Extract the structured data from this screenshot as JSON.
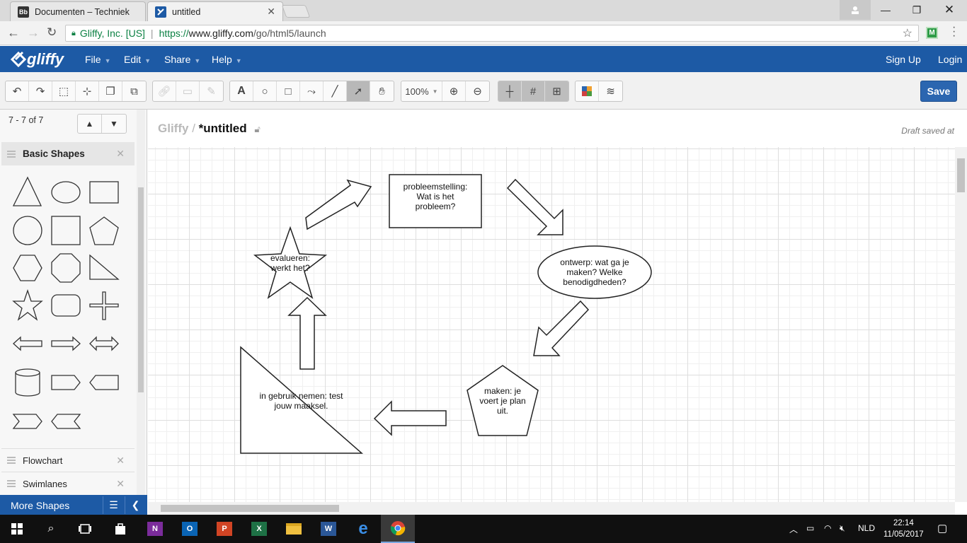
{
  "browser": {
    "tabs": [
      {
        "title": "Documenten – Techniek",
        "favicon": "Bb"
      },
      {
        "title": "untitled"
      }
    ],
    "address": {
      "secure_label": "Gliffy, Inc. [US]",
      "url_prefix": "https://",
      "url_host": "www.gliffy.com",
      "url_path": "/go/html5/launch"
    },
    "extension_label": "M"
  },
  "app": {
    "logo": "gliffy",
    "menu": [
      "File",
      "Edit",
      "Share",
      "Help"
    ],
    "sign_up": "Sign Up",
    "login": "Login",
    "zoom": "100%",
    "save_label": "Save",
    "accent": "#1d5aa5"
  },
  "sidebar": {
    "pager": "7 - 7 of 7",
    "libraries": [
      {
        "label": "Basic Shapes"
      },
      {
        "label": "Flowchart"
      },
      {
        "label": "Swimlanes"
      }
    ],
    "more_shapes": "More Shapes"
  },
  "document": {
    "brand": "Gliffy",
    "separator": "/",
    "title": "*untitled",
    "draft_status": "Draft saved at"
  },
  "diagram": {
    "box_text": [
      "probleemstelling:",
      "Wat is het",
      "probleem?"
    ],
    "ellipse_text": [
      "ontwerp: wat ga je",
      "maken? Welke",
      "benodigdheden?"
    ],
    "pentagon_text": [
      "maken: je",
      "voert je plan",
      "uit."
    ],
    "triangle_text": [
      "in gebruik nemen: test",
      "jouw maaksel."
    ],
    "star_text": [
      "evalueren:",
      "werkt het?"
    ]
  },
  "taskbar": {
    "lang": "NLD",
    "time": "22:14",
    "date": "11/05/2017"
  }
}
